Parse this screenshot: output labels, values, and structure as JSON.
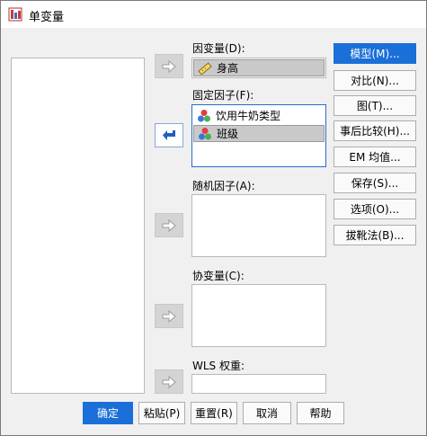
{
  "window": {
    "title": "单变量"
  },
  "dependent": {
    "label": "因变量(D):",
    "variable": "身高"
  },
  "fixed_factors": {
    "label": "固定因子(F):",
    "items": [
      "饮用牛奶类型",
      "班级"
    ]
  },
  "random_factors": {
    "label": "随机因子(A):"
  },
  "covariates": {
    "label": "协变量(C):"
  },
  "wls": {
    "label": "WLS 权重:"
  },
  "side_buttons": [
    "模型(M)...",
    "对比(N)...",
    "图(T)...",
    "事后比较(H)...",
    "EM 均值...",
    "保存(S)...",
    "选项(O)...",
    "拔靴法(B)..."
  ],
  "footer_buttons": [
    "确定",
    "粘贴(P)",
    "重置(R)",
    "取消",
    "帮助"
  ],
  "colors": {
    "accent": "#1a6fd8"
  }
}
